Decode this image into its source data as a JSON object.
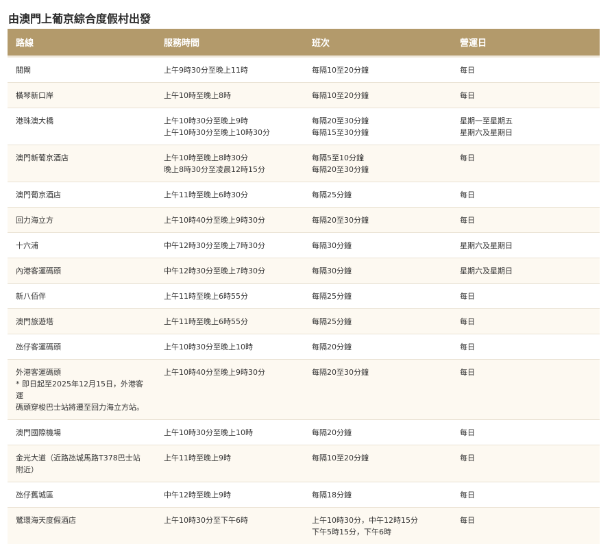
{
  "title": "由澳門上葡京綜合度假村出發",
  "headers": [
    "路線",
    "服務時間",
    "班次",
    "營運日"
  ],
  "rows": [
    {
      "route": [
        "關閘"
      ],
      "time": [
        "上午9時30分至晚上11時"
      ],
      "freq": [
        "每隔10至20分鐘"
      ],
      "days": [
        "每日"
      ]
    },
    {
      "route": [
        "橫琴新口岸"
      ],
      "time": [
        "上午10時至晚上8時"
      ],
      "freq": [
        "每隔10至20分鐘"
      ],
      "days": [
        "每日"
      ]
    },
    {
      "route": [
        "港珠澳大橋"
      ],
      "time": [
        "上午10時30分至晚上9時",
        "上午10時30分至晚上10時30分"
      ],
      "freq": [
        "每隔20至30分鐘",
        "每隔15至30分鐘"
      ],
      "days": [
        "星期一至星期五",
        "星期六及星期日"
      ]
    },
    {
      "route": [
        "澳門新葡京酒店"
      ],
      "time": [
        "上午10時至晚上8時30分",
        "晚上8時30分至凌晨12時15分"
      ],
      "freq": [
        "每隔5至10分鐘",
        "每隔20至30分鐘"
      ],
      "days": [
        "每日"
      ]
    },
    {
      "route": [
        "澳門葡京酒店"
      ],
      "time": [
        "上午11時至晚上6時30分"
      ],
      "freq": [
        "每隔25分鐘"
      ],
      "days": [
        "每日"
      ]
    },
    {
      "route": [
        "回力海立方"
      ],
      "time": [
        "上午10時40分至晚上9時30分"
      ],
      "freq": [
        "每隔20至30分鐘"
      ],
      "days": [
        "每日"
      ]
    },
    {
      "route": [
        "十六浦"
      ],
      "time": [
        "中午12時30分至晚上7時30分"
      ],
      "freq": [
        "每隔30分鐘"
      ],
      "days": [
        "星期六及星期日"
      ]
    },
    {
      "route": [
        "內港客運碼頭"
      ],
      "time": [
        "中午12時30分至晚上7時30分"
      ],
      "freq": [
        "每隔30分鐘"
      ],
      "days": [
        "星期六及星期日"
      ]
    },
    {
      "route": [
        "新八佰伴"
      ],
      "time": [
        "上午11時至晚上6時55分"
      ],
      "freq": [
        "每隔25分鐘"
      ],
      "days": [
        "每日"
      ]
    },
    {
      "route": [
        "澳門旅遊塔"
      ],
      "time": [
        "上午11時至晚上6時55分"
      ],
      "freq": [
        "每隔25分鐘"
      ],
      "days": [
        "每日"
      ]
    },
    {
      "route": [
        "氹仔客運碼頭"
      ],
      "time": [
        "上午10時30分至晚上10時"
      ],
      "freq": [
        "每隔20分鐘"
      ],
      "days": [
        "每日"
      ]
    },
    {
      "route": [
        "外港客運碼頭",
        "* 即日起至2025年12月15日，外港客運",
        "碼頭穿梭巴士站將遷至回力海立方站。"
      ],
      "time": [
        "上午10時40分至晚上9時30分"
      ],
      "freq": [
        "每隔20至30分鐘"
      ],
      "days": [
        "每日"
      ]
    },
    {
      "route": [
        "澳門國際機場"
      ],
      "time": [
        "上午10時30分至晚上10時"
      ],
      "freq": [
        "每隔20分鐘"
      ],
      "days": [
        "每日"
      ]
    },
    {
      "route": [
        "金光大道（近路氹城馬路T378巴士站",
        "附近）"
      ],
      "time": [
        "上午11時至晚上9時"
      ],
      "freq": [
        "每隔10至20分鐘"
      ],
      "days": [
        "每日"
      ]
    },
    {
      "route": [
        "氹仔舊城區"
      ],
      "time": [
        "中午12時至晚上9時"
      ],
      "freq": [
        "每隔18分鐘"
      ],
      "days": [
        "每日"
      ]
    },
    {
      "route": [
        "鷺環海天度假酒店"
      ],
      "time": [
        "上午10時30分至下午6時"
      ],
      "freq": [
        "上午10時30分，中午12時15分",
        "下午5時15分，下午6時"
      ],
      "days": [
        "每日"
      ]
    }
  ]
}
